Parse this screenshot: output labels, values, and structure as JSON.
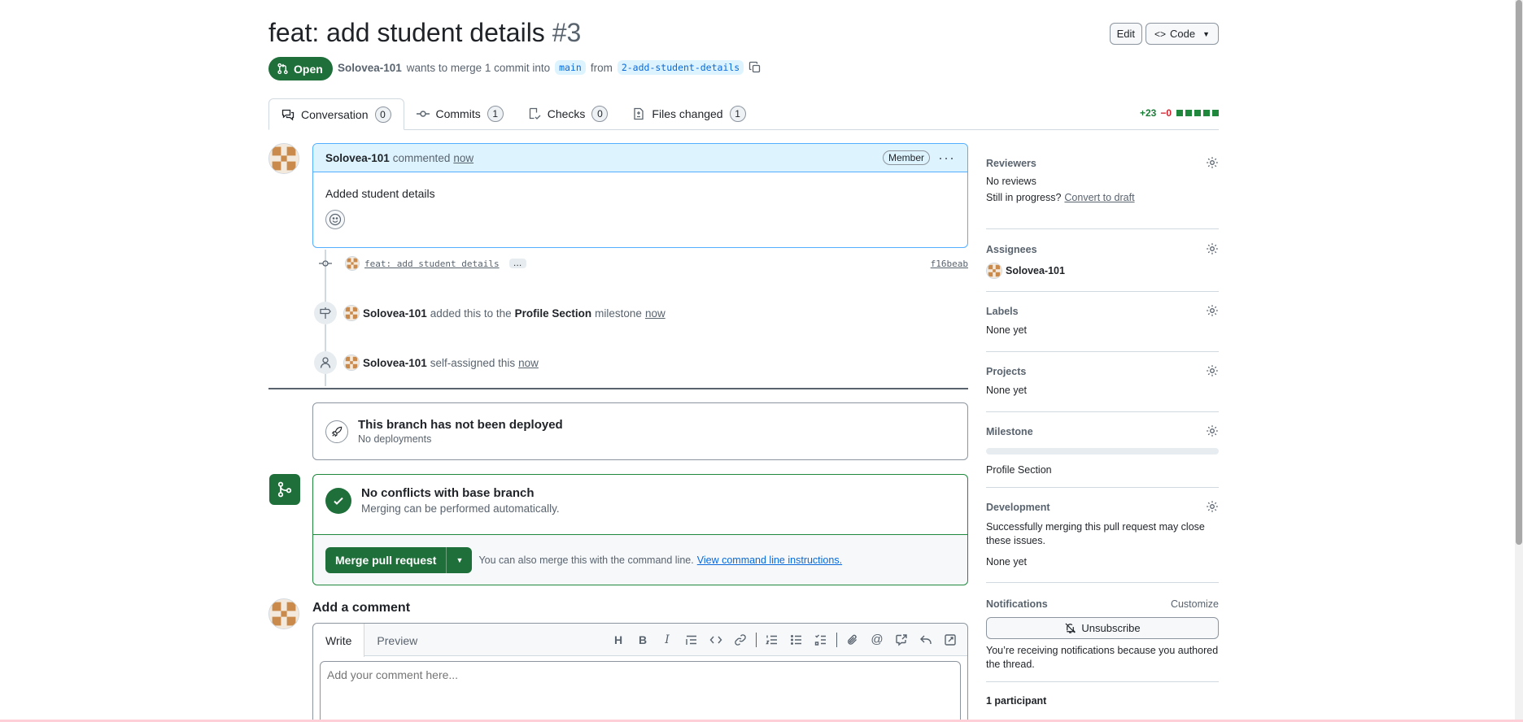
{
  "header": {
    "title": "feat: add student details",
    "number": "#3",
    "edit_label": "Edit",
    "code_label": "Code"
  },
  "status": {
    "state_label": "Open",
    "author": "Solovea-101",
    "merge_text": "wants to merge 1 commit into",
    "base_branch": "main",
    "from_text": "from",
    "head_branch": "2-add-student-details"
  },
  "tabs": [
    {
      "label": "Conversation",
      "count": "0"
    },
    {
      "label": "Commits",
      "count": "1"
    },
    {
      "label": "Checks",
      "count": "0"
    },
    {
      "label": "Files changed",
      "count": "1"
    }
  ],
  "diffstat": {
    "additions": "+23",
    "deletions": "−0"
  },
  "comment": {
    "author": "Solovea-101",
    "action": "commented",
    "time": "now",
    "role_badge": "Member",
    "body": "Added student details"
  },
  "timeline": {
    "commit_message": "feat: add student details",
    "commit_more": "…",
    "commit_sha": "f16beab",
    "milestone_event": {
      "actor": "Solovea-101",
      "text_before": "added this to the",
      "milestone": "Profile Section",
      "text_after": "milestone",
      "time": "now"
    },
    "assign_event": {
      "actor": "Solovea-101",
      "text": "self-assigned this",
      "time": "now"
    }
  },
  "deployment": {
    "title": "This branch has not been deployed",
    "subtitle": "No deployments"
  },
  "merge": {
    "title": "No conflicts with base branch",
    "subtitle": "Merging can be performed automatically.",
    "button_label": "Merge pull request",
    "hint_text": "You can also merge this with the command line.",
    "hint_link": "View command line instructions."
  },
  "add_comment": {
    "title": "Add a comment",
    "write_tab": "Write",
    "preview_tab": "Preview",
    "placeholder": "Add your comment here..."
  },
  "sidebar": {
    "reviewers": {
      "title": "Reviewers",
      "value": "No reviews",
      "progress_text": "Still in progress?",
      "draft_link": "Convert to draft"
    },
    "assignees": {
      "title": "Assignees",
      "value": "Solovea-101"
    },
    "labels": {
      "title": "Labels",
      "value": "None yet"
    },
    "projects": {
      "title": "Projects",
      "value": "None yet"
    },
    "milestone": {
      "title": "Milestone",
      "value": "Profile Section",
      "progress": 0
    },
    "development": {
      "title": "Development",
      "description": "Successfully merging this pull request may close these issues.",
      "value": "None yet"
    },
    "notifications": {
      "title": "Notifications",
      "customize": "Customize",
      "button": "Unsubscribe",
      "reason": "You’re receiving notifications because you authored the thread."
    },
    "participants": {
      "title": "1 participant"
    }
  },
  "colors": {
    "accent_green": "#1f6f3a",
    "link_blue": "#0969da",
    "comment_header": "#ddf4ff"
  }
}
